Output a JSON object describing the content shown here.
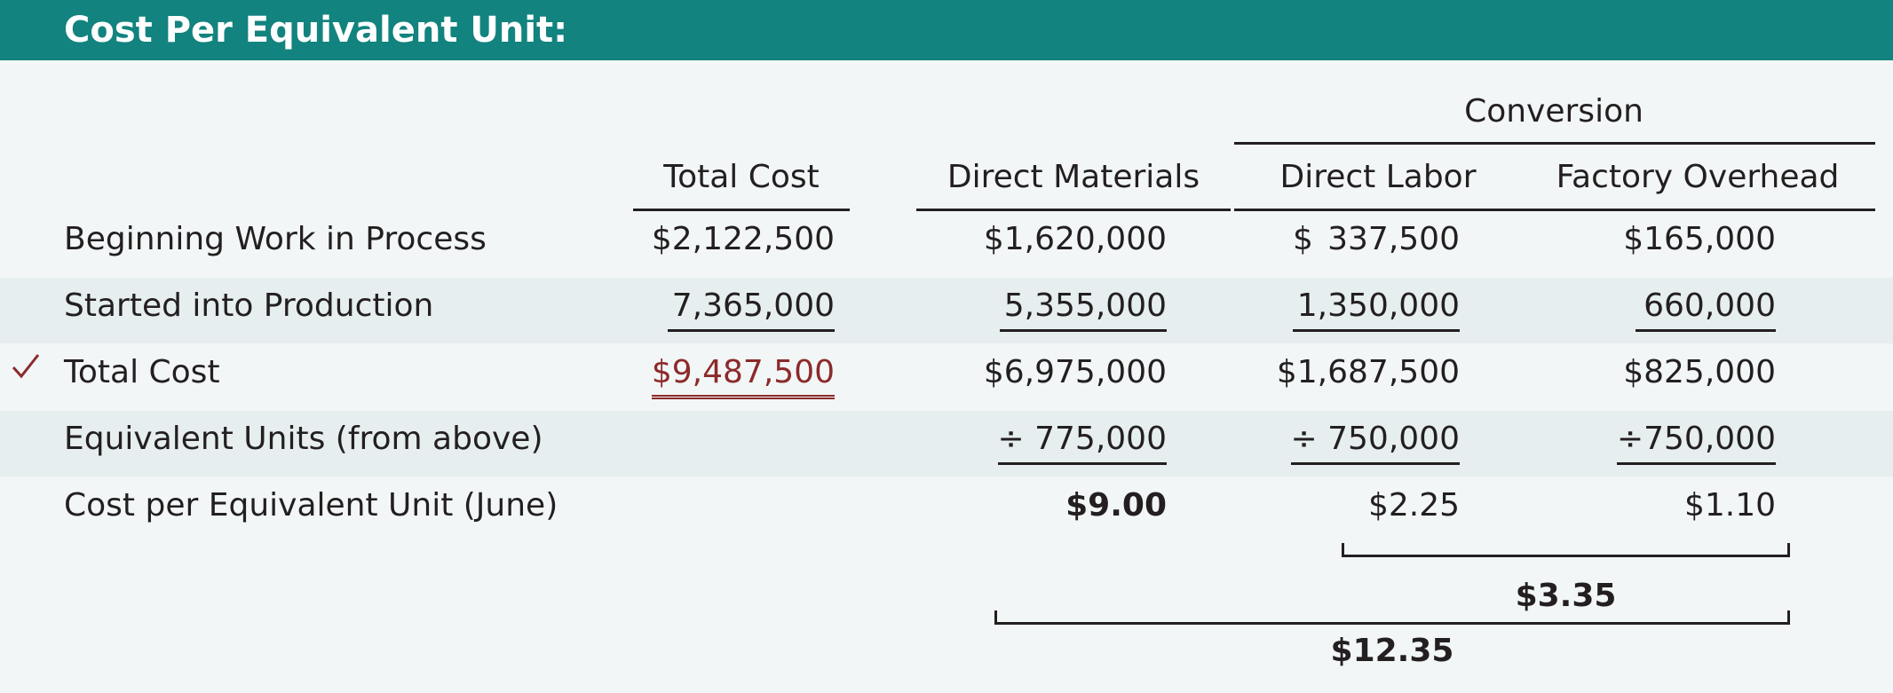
{
  "title": "Cost Per Equivalent Unit:",
  "header": {
    "conversion": "Conversion",
    "total_cost": "Total Cost",
    "direct_materials": "Direct Materials",
    "direct_labor": "Direct  Labor",
    "factory_overhead": "Factory Overhead"
  },
  "rows": [
    {
      "label": "Beginning Work in Process",
      "total": "$2,122,500",
      "dm": "$1,620,000",
      "dl_symbol": "$",
      "dl": "337,500",
      "foh": "$165,000"
    },
    {
      "label": "Started into Production",
      "total": "7,365,000",
      "dm": "5,355,000",
      "dl": "1,350,000",
      "foh": "660,000"
    },
    {
      "label": "Total Cost",
      "total": "$9,487,500",
      "dm": "$6,975,000",
      "dl": "$1,687,500",
      "foh": "$825,000"
    },
    {
      "label": "Equivalent Units (from above)",
      "dm": "÷  775,000",
      "dl": "÷  750,000",
      "foh": "÷750,000"
    },
    {
      "label": "Cost per Equivalent Unit (June)",
      "dm": "$9.00",
      "dl": "$2.25",
      "foh": "$1.10"
    }
  ],
  "totals": {
    "conversion_cost": "$3.35",
    "total_cost_per_unit": "$12.35"
  },
  "check_icon": "checkmark-icon",
  "colors": {
    "banner": "#12837e",
    "accent_red": "#8c2a2a",
    "band": "#e6eeef",
    "background": "#f2f6f7"
  }
}
